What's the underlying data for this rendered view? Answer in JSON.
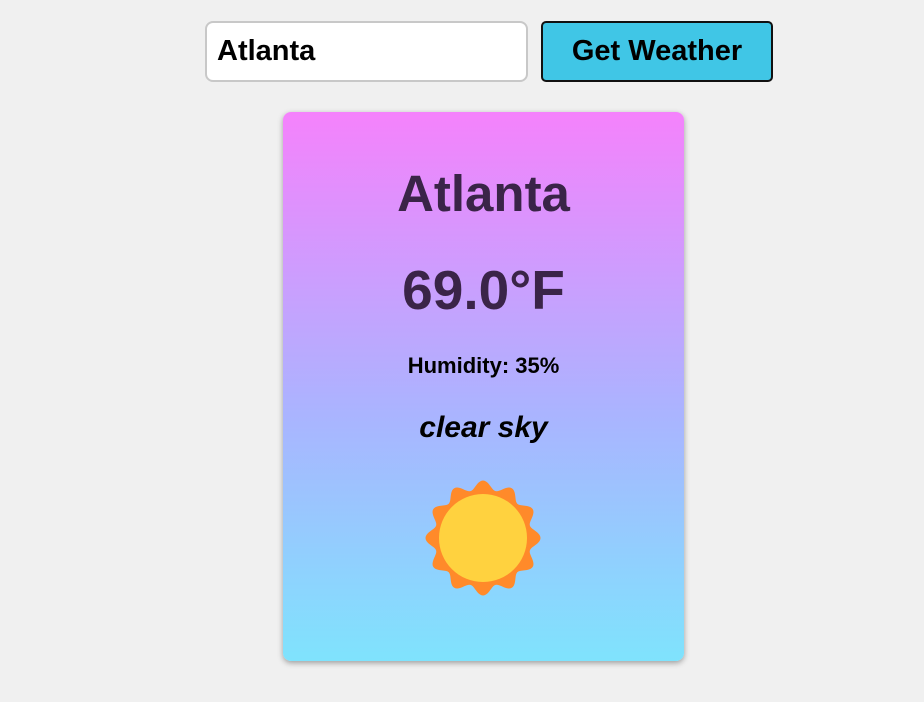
{
  "search": {
    "value": "Atlanta",
    "button_label": "Get Weather"
  },
  "weather": {
    "city": "Atlanta",
    "temperature": "69.0°F",
    "humidity": "Humidity: 35%",
    "description": "clear sky",
    "icon": "sun-icon"
  },
  "colors": {
    "page_background": "#f0f0f0",
    "button_background": "#40c6e6",
    "card_gradient_top": "#f582fc",
    "card_gradient_middle": "#aab4ff",
    "card_gradient_bottom": "#7fe3fd",
    "heading_text": "#3a2448",
    "sun_rays": "#ff8a2a",
    "sun_core": "#ffd23f"
  }
}
